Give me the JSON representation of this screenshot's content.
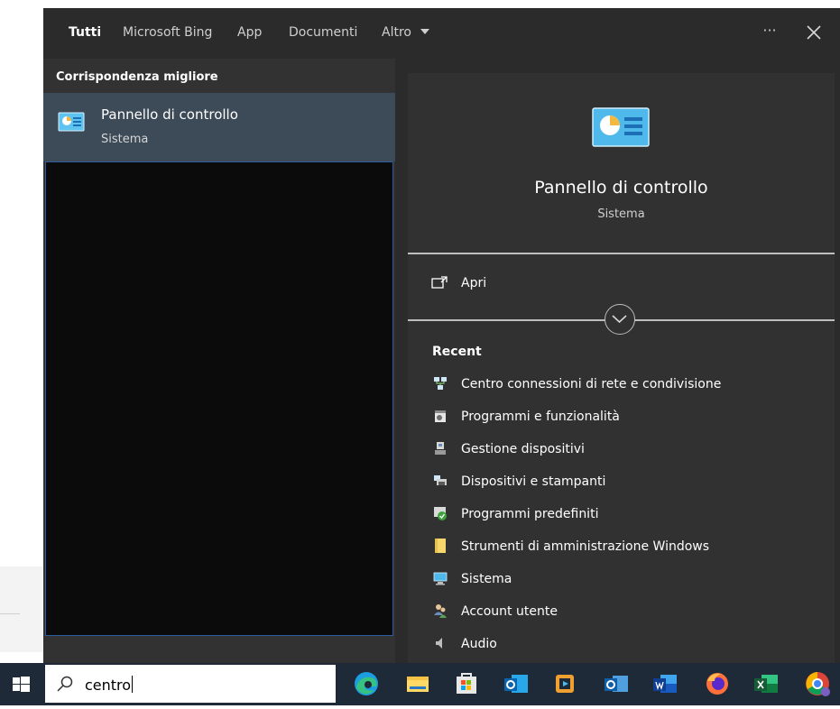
{
  "tabs": [
    {
      "label": "Tutti",
      "active": true
    },
    {
      "label": "Microsoft Bing",
      "active": false
    },
    {
      "label": "App",
      "active": false
    },
    {
      "label": "Documenti",
      "active": false
    },
    {
      "label": "Altro",
      "active": false
    }
  ],
  "header_icons": {
    "more": "ellipsis-icon",
    "more_label": "···",
    "close": "close-icon"
  },
  "left": {
    "section_title": "Corrispondenza migliore",
    "best_match": {
      "name": "Pannello di controllo",
      "category": "Sistema",
      "icon": "control-panel-icon"
    }
  },
  "preview": {
    "title": "Pannello di controllo",
    "category": "Sistema",
    "open_label": "Apri",
    "recent_title": "Recent",
    "recent": [
      {
        "label": "Centro connessioni di rete e condivisione",
        "icon": "network-icon"
      },
      {
        "label": "Programmi e funzionalità",
        "icon": "programs-icon"
      },
      {
        "label": "Gestione dispositivi",
        "icon": "device-manager-icon"
      },
      {
        "label": "Dispositivi e stampanti",
        "icon": "printer-icon"
      },
      {
        "label": "Programmi predefiniti",
        "icon": "default-programs-icon"
      },
      {
        "label": "Strumenti di amministrazione Windows",
        "icon": "folder-icon"
      },
      {
        "label": "Sistema",
        "icon": "system-icon"
      },
      {
        "label": "Account utente",
        "icon": "users-icon"
      },
      {
        "label": "Audio",
        "icon": "audio-icon"
      }
    ]
  },
  "taskbar": {
    "search_value": "centro",
    "apps": [
      "edge-icon",
      "file-explorer-icon",
      "store-icon",
      "outlook-icon",
      "media-player-icon",
      "outlook-new-icon",
      "word-icon",
      "firefox-icon",
      "excel-icon",
      "chrome-icon"
    ]
  },
  "colors": {
    "panel": "#2b2b2b",
    "selected": "#3d4a57",
    "taskbar": "#1f2a38",
    "accent": "#2f5c9e"
  }
}
